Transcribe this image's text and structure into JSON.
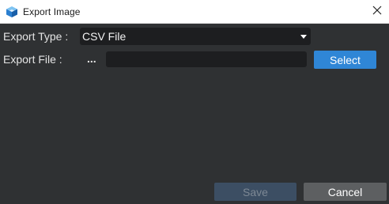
{
  "window": {
    "title": "Export Image",
    "app_icon": "3d-cube-app-icon",
    "close_icon": "close-icon"
  },
  "form": {
    "export_type_label": "Export Type :",
    "export_type_value": "CSV File",
    "export_file_label": "Export File :",
    "ellipsis": "...",
    "file_path_value": ""
  },
  "buttons": {
    "select_label": "Select",
    "save_label": "Save",
    "cancel_label": "Cancel",
    "save_enabled": false
  },
  "colors": {
    "background": "#2f3133",
    "field_background": "#1d1e20",
    "accent": "#2f86d6",
    "disabled_button": "#3c4e63",
    "secondary_button": "#5d5f61"
  }
}
